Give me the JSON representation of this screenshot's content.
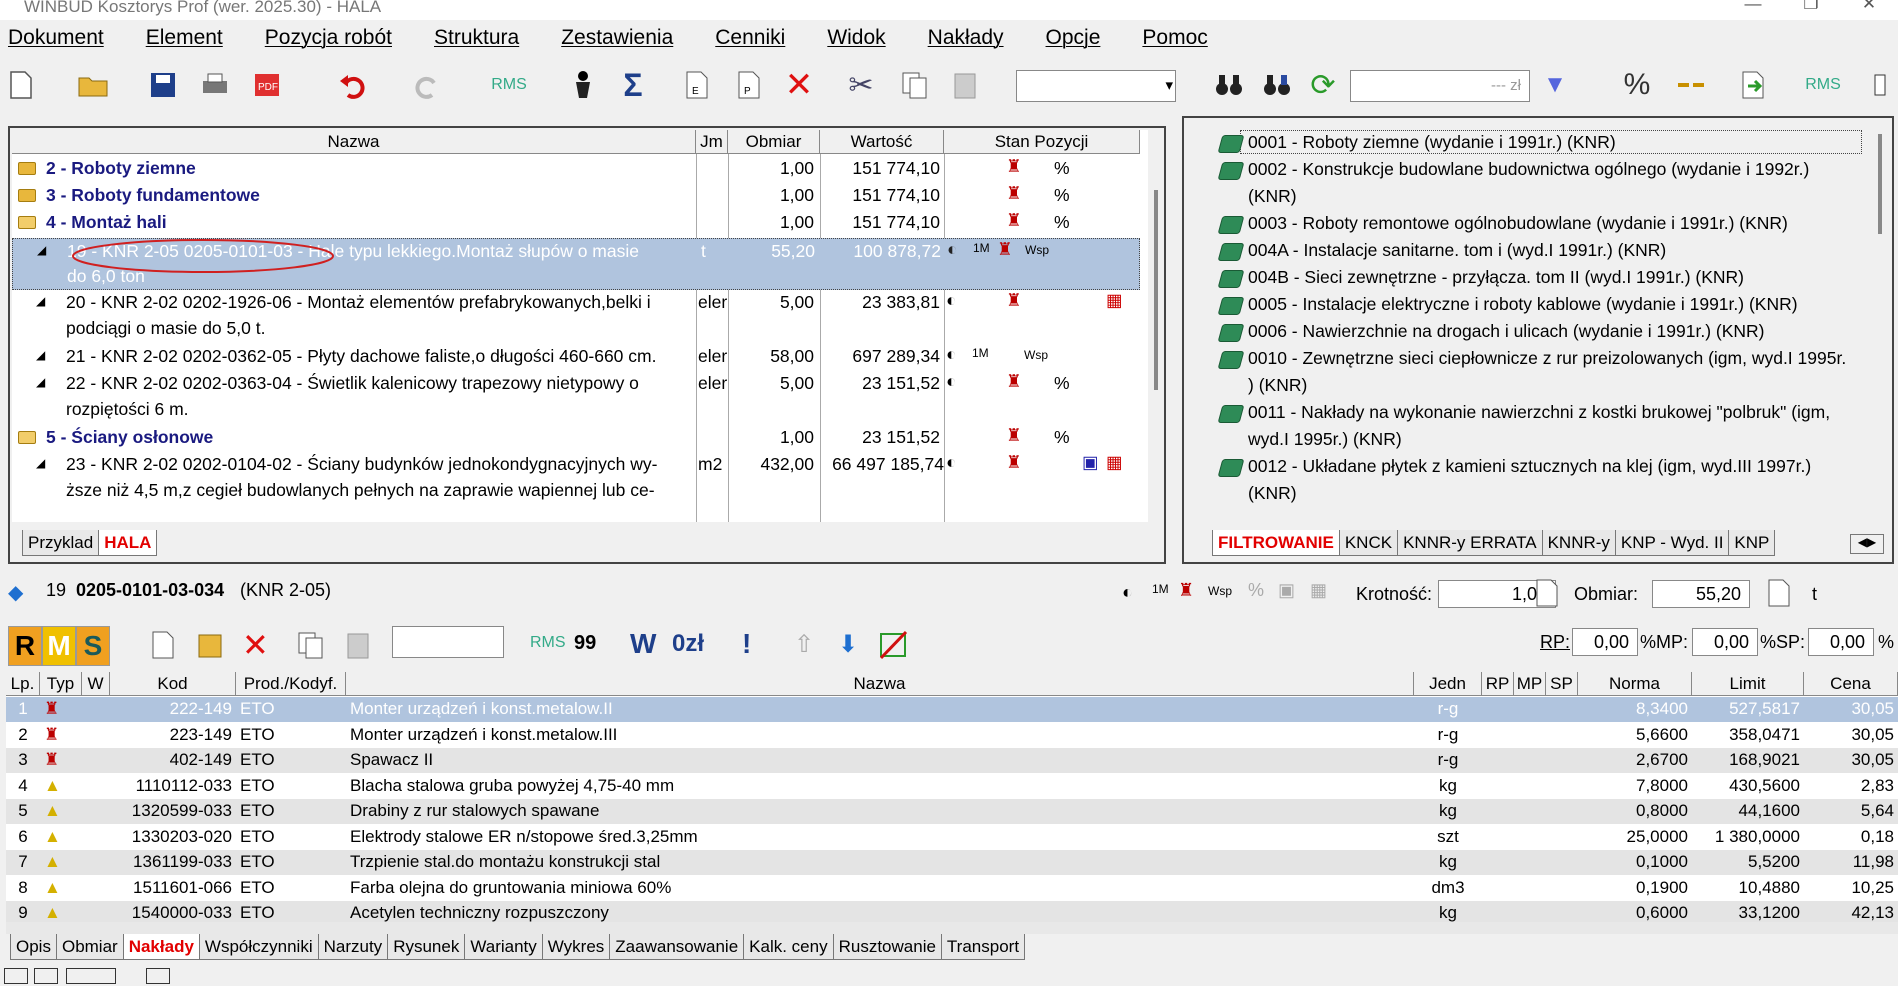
{
  "window": {
    "title": "WINBUD Kosztorys Prof (wer. 2025.30) - HALA",
    "minimize": "—",
    "restore": "❐",
    "close": "✕"
  },
  "menu": [
    "Dokument",
    "Element",
    "Pozycja robót",
    "Struktura",
    "Zestawienia",
    "Cenniki",
    "Widok",
    "Nakłady",
    "Opcje",
    "Pomoc"
  ],
  "toolbar": {
    "search_placeholder": "--- zł",
    "zoom_value": ""
  },
  "main_table": {
    "headers": [
      "Nazwa",
      "Jm",
      "Obmiar",
      "Wartość",
      "Stan Pozycji"
    ],
    "rows": [
      {
        "type": "folder",
        "name": "2 - Roboty ziemne",
        "jm": "",
        "obmiar": "1,00",
        "wartosc": "151 774,10",
        "stan": "%"
      },
      {
        "type": "folder",
        "name": "3 - Roboty fundamentowe",
        "jm": "",
        "obmiar": "1,00",
        "wartosc": "151 774,10",
        "stan": "%"
      },
      {
        "type": "folder-open",
        "name": "4 - Montaż hali",
        "jm": "",
        "obmiar": "1,00",
        "wartosc": "151 774,10",
        "stan": "%"
      },
      {
        "type": "item",
        "selected": true,
        "name_a": "19 - KNR 2-05 0205-0101-03 - Hale typu lekkiego.Montaż słupów o masie",
        "name_b": "do 6,0 ton",
        "jm": "t",
        "obmiar": "55,20",
        "wartosc": "100 878,72",
        "stan": "Wsp"
      },
      {
        "type": "item",
        "name_a": "20 - KNR 2-02 0202-1926-06 - Montaż elementów prefabrykowanych,belki i",
        "name_b": "podciągi o masie do 5,0 t.",
        "jm": "eler",
        "obmiar": "5,00",
        "wartosc": "23 383,81",
        "stan": ""
      },
      {
        "type": "item",
        "name_a": "21 - KNR 2-02 0202-0362-05 - Płyty dachowe faliste,o długości 460-660 cm.",
        "name_b": "",
        "jm": "eler",
        "obmiar": "58,00",
        "wartosc": "697 289,34",
        "stan": "Wsp"
      },
      {
        "type": "item",
        "name_a": "22 - KNR 2-02 0202-0363-04 - Świetlik kalenicowy trapezowy nietypowy o",
        "name_b": "rozpiętości 6 m.",
        "jm": "eler",
        "obmiar": "5,00",
        "wartosc": "23 151,52",
        "stan": "%"
      },
      {
        "type": "folder-open",
        "name": "5 - Ściany osłonowe",
        "jm": "",
        "obmiar": "1,00",
        "wartosc": "23 151,52",
        "stan": "%"
      },
      {
        "type": "item",
        "name_a": "23 - KNR 2-02 0202-0104-02 - Ściany budynków jednokondygnacyjnych wy-",
        "name_b": "ższe niż 4,5 m,z cegieł budowlanych pełnych na zaprawie wapiennej lub ce-",
        "jm": "m2",
        "obmiar": "432,00",
        "wartosc": "66 497 185,74",
        "stan": ""
      }
    ]
  },
  "left_tabs": [
    "Przyklad",
    "HALA"
  ],
  "catalog": [
    "0001 - Roboty ziemne (wydanie i 1991r.) (KNR)",
    "0002 - Konstrukcje budowlane budownictwa ogólnego (wydanie i 1992r.)",
    "(KNR)",
    "0003 - Roboty remontowe ogólnobudowlane (wydanie i 1991r.) (KNR)",
    "004A - Instalacje sanitarne. tom i (wyd.I 1991r.) (KNR)",
    "004B - Sieci zewnętrzne - przyłącza. tom II (wyd.I 1991r.) (KNR)",
    "0005 - Instalacje elektryczne i roboty kablowe (wydanie i 1991r.) (KNR)",
    "0006 - Nawierzchnie na drogach i ulicach (wydanie i 1991r.) (KNR)",
    "0010 - Zewnętrzne sieci ciepłownicze z rur preizolowanych (igm, wyd.I 1995r.",
    ") (KNR)",
    "0011 - Nakłady na wykonanie nawierzchni z kostki brukowej \"polbruk\" (igm,",
    "wyd.I 1995r.) (KNR)",
    "0012 - Układane płytek z kamieni sztucznych na klej (igm, wyd.III 1997r.)",
    "(KNR)"
  ],
  "catalog_tabs": [
    "FILTROWANIE",
    "KNCK",
    "KNNR-y ERRATA",
    "KNNR-y",
    "KNP - Wyd. II",
    "KNP"
  ],
  "detail": {
    "lp": "19",
    "code": "0205-0101-03-034",
    "catalog": "(KNR 2-05)",
    "krotnosc_label": "Krotność:",
    "krotnosc": "1,00",
    "obmiar_label": "Obmiar:",
    "obmiar": "55,20",
    "unit": "t",
    "wsp": "Wsp"
  },
  "rms_bar": {
    "R": "R",
    "M": "M",
    "S": "S",
    "W": "W",
    "zl": "0zł",
    "excl": "!",
    "ninety": "99",
    "rp_label": "RP:",
    "rp": "0,00",
    "mp_label": "%MP:",
    "mp": "0,00",
    "sp_label": "%SP:",
    "sp": "0,00",
    "pct": "%"
  },
  "naklady": {
    "headers": [
      "Lp.",
      "Typ",
      "W",
      "Kod",
      "Prod./Kodyf.",
      "Nazwa",
      "Jedn",
      "RP",
      "MP",
      "SP",
      "Norma",
      "Limit",
      "Cena"
    ],
    "rows": [
      {
        "lp": "1",
        "typ": "R",
        "kod": "222-149",
        "prod": "ETO",
        "nazwa": "Monter urządzeń i konst.metalow.II",
        "jedn": "r-g",
        "norma": "8,3400",
        "limit": "527,5817",
        "cena": "30,05",
        "selected": true
      },
      {
        "lp": "2",
        "typ": "R",
        "kod": "223-149",
        "prod": "ETO",
        "nazwa": "Monter urządzeń i konst.metalow.III",
        "jedn": "r-g",
        "norma": "5,6600",
        "limit": "358,0471",
        "cena": "30,05"
      },
      {
        "lp": "3",
        "typ": "R",
        "kod": "402-149",
        "prod": "ETO",
        "nazwa": "Spawacz II",
        "jedn": "r-g",
        "norma": "2,6700",
        "limit": "168,9021",
        "cena": "30,05"
      },
      {
        "lp": "4",
        "typ": "M",
        "kod": "1110112-033",
        "prod": "ETO",
        "nazwa": "Blacha stalowa gruba powyżej 4,75-40 mm",
        "jedn": "kg",
        "norma": "7,8000",
        "limit": "430,5600",
        "cena": "2,83"
      },
      {
        "lp": "5",
        "typ": "M",
        "kod": "1320599-033",
        "prod": "ETO",
        "nazwa": "Drabiny z rur stalowych spawane",
        "jedn": "kg",
        "norma": "0,8000",
        "limit": "44,1600",
        "cena": "5,64"
      },
      {
        "lp": "6",
        "typ": "M",
        "kod": "1330203-020",
        "prod": "ETO",
        "nazwa": "Elektrody stalowe ER n/stopowe śred.3,25mm",
        "jedn": "szt",
        "norma": "25,0000",
        "limit": "1 380,0000",
        "cena": "0,18"
      },
      {
        "lp": "7",
        "typ": "M",
        "kod": "1361199-033",
        "prod": "ETO",
        "nazwa": "Trzpienie stal.do montażu konstrukcji stal",
        "jedn": "kg",
        "norma": "0,1000",
        "limit": "5,5200",
        "cena": "11,98"
      },
      {
        "lp": "8",
        "typ": "M",
        "kod": "1511601-066",
        "prod": "ETO",
        "nazwa": "Farba olejna do gruntowania miniowa 60%",
        "jedn": "dm3",
        "norma": "0,1900",
        "limit": "10,4880",
        "cena": "10,25"
      },
      {
        "lp": "9",
        "typ": "M",
        "kod": "1540000-033",
        "prod": "ETO",
        "nazwa": "Acetylen techniczny rozpuszczony",
        "jedn": "kg",
        "norma": "0,6000",
        "limit": "33,1200",
        "cena": "42,13"
      }
    ]
  },
  "bottom_tabs": [
    "Opis",
    "Obmiar",
    "Nakłady",
    "Współczynniki",
    "Narzuty",
    "Rysunek",
    "Warianty",
    "Wykres",
    "Zaawansowanie",
    "Kalk. ceny",
    "Rusztowanie",
    "Transport"
  ],
  "colors": {
    "selected": "#b0c4de",
    "active_tab": "#e20000",
    "folder_text": "#1a1a80",
    "R": "#f0a020",
    "M": "#f0c000",
    "S": "#40b0b0"
  }
}
